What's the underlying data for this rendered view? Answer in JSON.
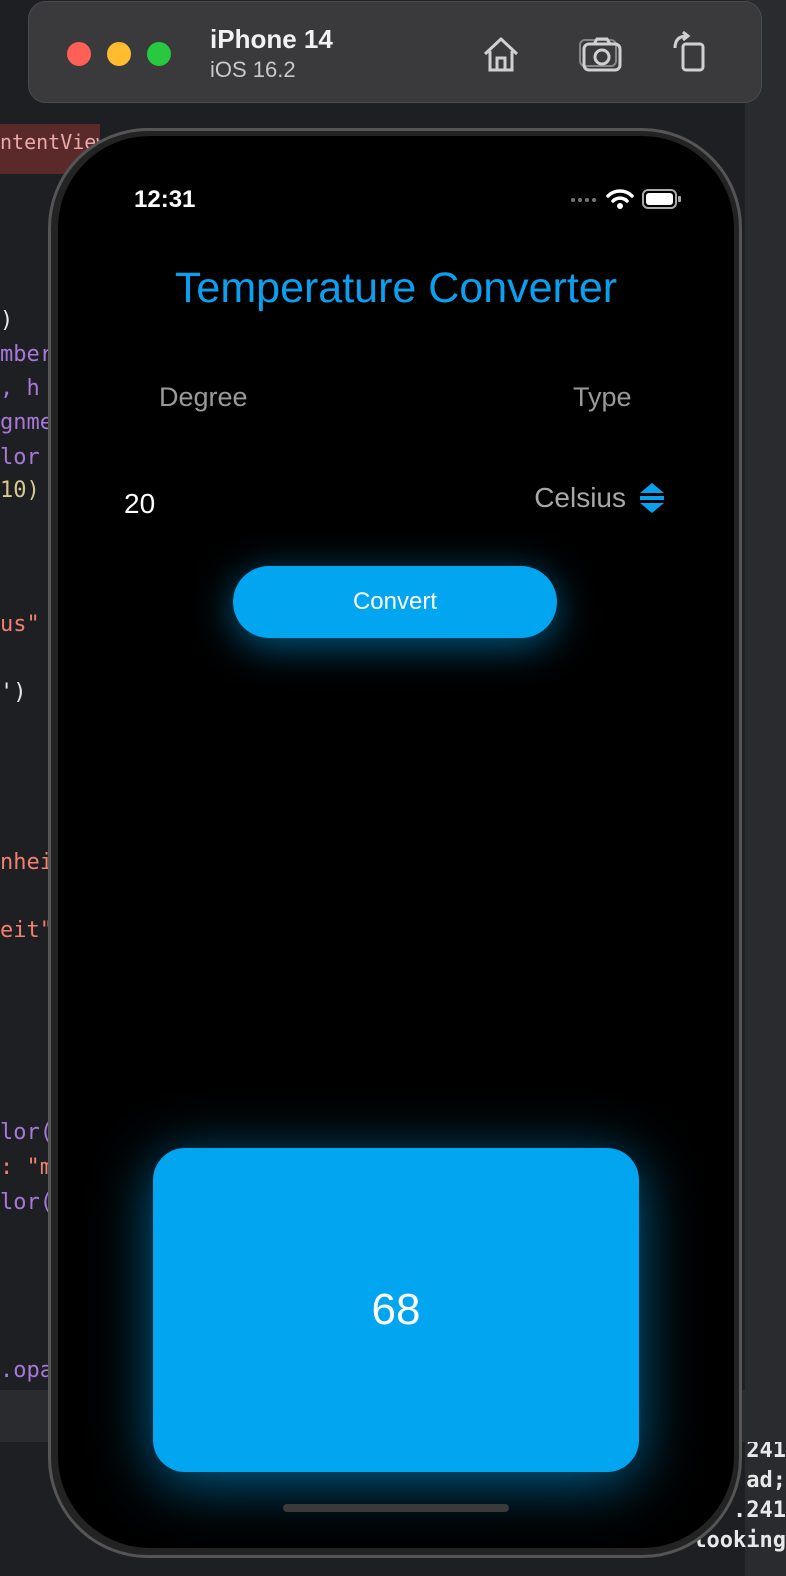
{
  "simulator": {
    "device": "iPhone 14",
    "os": "iOS 16.2"
  },
  "background_code": {
    "tab": "ntentView",
    "left_lines": [
      {
        "text": ")",
        "color": "#e8e8e8"
      },
      {
        "text": "mber",
        "color": "#a678d8"
      },
      {
        "text": ", h",
        "color": "#a678d8"
      },
      {
        "text": "gnme",
        "color": "#a678d8"
      },
      {
        "text": "lor",
        "color": "#a678d8"
      },
      {
        "text": "10)",
        "color": "#d8c890"
      },
      {
        "text": "us\"",
        "color": "#f08070"
      },
      {
        "text": "')",
        "color": "#e8e8e8"
      },
      {
        "text": "nhei",
        "color": "#f08070"
      },
      {
        "text": "eit\"",
        "color": "#f08070"
      },
      {
        "text": "lor(",
        "color": "#a678d8"
      },
      {
        "text": ": \"m",
        "color": "#f08070"
      },
      {
        "text": "lor(",
        "color": "#a678d8"
      },
      {
        "text": ".opa",
        "color": "#a678d8"
      }
    ],
    "right_lines": [
      ".241",
      "ad;",
      ".241",
      "looking"
    ]
  },
  "status_bar": {
    "time": "12:31"
  },
  "app": {
    "title": "Temperature Converter",
    "degree_header": "Degree",
    "type_header": "Type",
    "degree_value": "20",
    "type_value": "Celsius",
    "convert_label": "Convert",
    "result": "68",
    "accent_color": "#02a5ef"
  }
}
